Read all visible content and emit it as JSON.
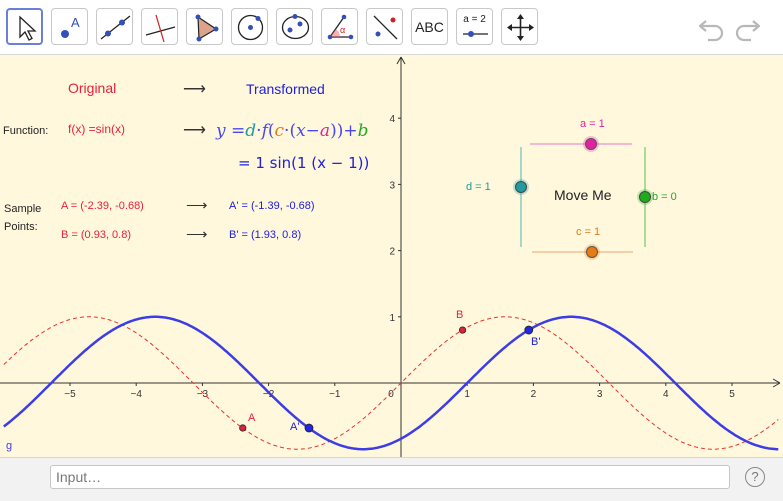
{
  "toolbar": {
    "tools": [
      {
        "name": "move-tool",
        "icon": "arrow-pointer-icon"
      },
      {
        "name": "point-tool",
        "icon": "point-icon",
        "label": "A"
      },
      {
        "name": "line-tool",
        "icon": "line-through-points-icon"
      },
      {
        "name": "perpendicular-line-tool",
        "icon": "perpendicular-icon"
      },
      {
        "name": "polygon-tool",
        "icon": "polygon-icon"
      },
      {
        "name": "circle-tool",
        "icon": "circle-center-icon"
      },
      {
        "name": "conic-tool",
        "icon": "ellipse-icon"
      },
      {
        "name": "angle-tool",
        "icon": "angle-icon",
        "label": "α"
      },
      {
        "name": "reflect-tool",
        "icon": "reflect-about-line-icon"
      },
      {
        "name": "text-tool",
        "icon": "text-icon",
        "label": "ABC"
      },
      {
        "name": "slider-tool",
        "icon": "slider-icon",
        "label": "a = 2"
      },
      {
        "name": "move-graphics-view-tool",
        "icon": "move-arrows-icon"
      }
    ],
    "undo_icon": "undo-icon",
    "redo_icon": "redo-icon"
  },
  "graphics": {
    "header_original": "Original",
    "header_arrow": "⟶",
    "header_transformed": "Transformed",
    "function_label": "Function:",
    "function_original": "f(x) =sin(x)",
    "function_arrow": "⟶",
    "formula": {
      "y": "y",
      "eq": " =",
      "d": "d",
      "dot1": "·",
      "f": "f",
      "paren1": "(",
      "c": "c",
      "dot2": "·",
      "paren2": "(",
      "x": "x",
      "minus": "−",
      "a": "a",
      "close": "))",
      "plus": "+",
      "b": "b"
    },
    "formula_evaluated": "= 1  sin(1  (x − 1))",
    "sample_label_1": "Sample",
    "sample_label_2": "Points:",
    "point_A": "A = (-2.39, -0.68)",
    "point_A_arrow": "⟶",
    "point_A_prime": "A' = (-1.39, -0.68)",
    "point_B": "B = (0.93, 0.8)",
    "point_B_arrow": "⟶",
    "point_B_prime": "B' = (1.93, 0.8)",
    "slider_a": "a = 1",
    "slider_b": "b = 0",
    "slider_c": "c = 1",
    "slider_d": "d = 1",
    "move_me": "Move Me",
    "marker_A": "A",
    "marker_A_prime": "A'",
    "marker_B": "B",
    "marker_B_prime": "B'",
    "g_label": "g",
    "x_ticks": [
      "−5",
      "−4",
      "−3",
      "−2",
      "−1",
      "0",
      "1",
      "2",
      "3",
      "4",
      "5"
    ],
    "y_ticks": [
      "1",
      "2",
      "3",
      "4"
    ]
  },
  "chart_data": {
    "type": "line",
    "series": [
      {
        "name": "f(x) = sin(x)",
        "color": "#e8312f",
        "style": "dashed"
      },
      {
        "name": "g",
        "color": "#3d3de6",
        "style": "solid"
      }
    ],
    "parameters": {
      "a": 1,
      "b": 0,
      "c": 1,
      "d": 1
    },
    "points": [
      {
        "label": "A",
        "x": -2.39,
        "y": -0.68
      },
      {
        "label": "A'",
        "x": -1.39,
        "y": -0.68
      },
      {
        "label": "B",
        "x": 0.93,
        "y": 0.8
      },
      {
        "label": "B'",
        "x": 1.93,
        "y": 0.8
      }
    ],
    "xlim": [
      -6,
      5.7
    ],
    "ylim": [
      -1.1,
      4.9
    ],
    "grid": false
  },
  "colors": {
    "original": "#e8312f",
    "transformed": "#2020dd",
    "a": "#e0209e",
    "b": "#22aa22",
    "c": "#e27a18",
    "d": "#1f9ba1",
    "background": "#fff8dd"
  },
  "input": {
    "placeholder": "Input…",
    "help": "?"
  }
}
